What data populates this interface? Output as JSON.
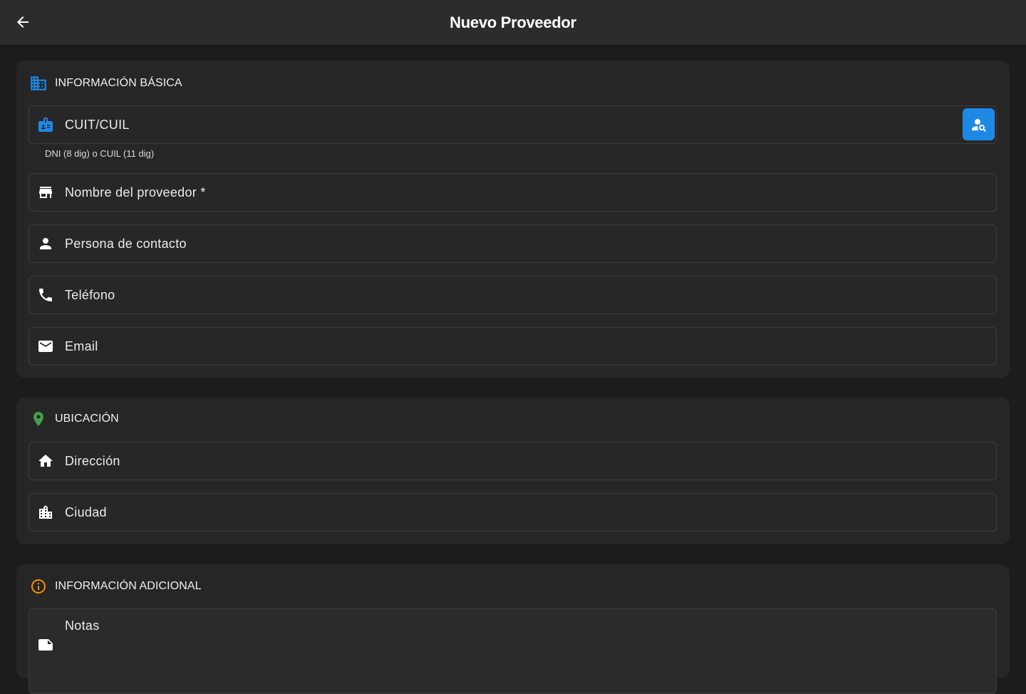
{
  "appbar": {
    "title": "Nuevo Proveedor",
    "back_icon": "arrow-back-icon"
  },
  "sections": {
    "basic": {
      "title": "INFORMACIÓN BÁSICA",
      "icon": "business-icon",
      "icon_color": "#1e88e5",
      "fields": {
        "cuit": {
          "label": "CUIT/CUIL",
          "icon": "badge-icon",
          "icon_color": "#1e88e5",
          "helper": "DNI (8 dig) o CUIL (11 dig)",
          "lookup_icon": "person-search-icon"
        },
        "name": {
          "label": "Nombre del proveedor *",
          "icon": "store-icon"
        },
        "contact": {
          "label": "Persona de contacto",
          "icon": "person-icon"
        },
        "phone": {
          "label": "Teléfono",
          "icon": "phone-icon"
        },
        "email": {
          "label": "Email",
          "icon": "mail-icon"
        }
      }
    },
    "location": {
      "title": "UBICACIÓN",
      "icon": "location-pin-icon",
      "icon_color": "#43a047",
      "fields": {
        "address": {
          "label": "Dirección",
          "icon": "home-icon"
        },
        "city": {
          "label": "Ciudad",
          "icon": "city-icon"
        }
      }
    },
    "additional": {
      "title": "INFORMACIÓN ADICIONAL",
      "icon": "info-icon",
      "icon_color": "#fb8c00",
      "fields": {
        "notes": {
          "label": "Notas",
          "icon": "note-icon"
        }
      }
    }
  },
  "colors": {
    "background": "#1c1c1c",
    "appbar": "#2c2c2c",
    "card": "#262626",
    "accent": "#1e88e5"
  }
}
